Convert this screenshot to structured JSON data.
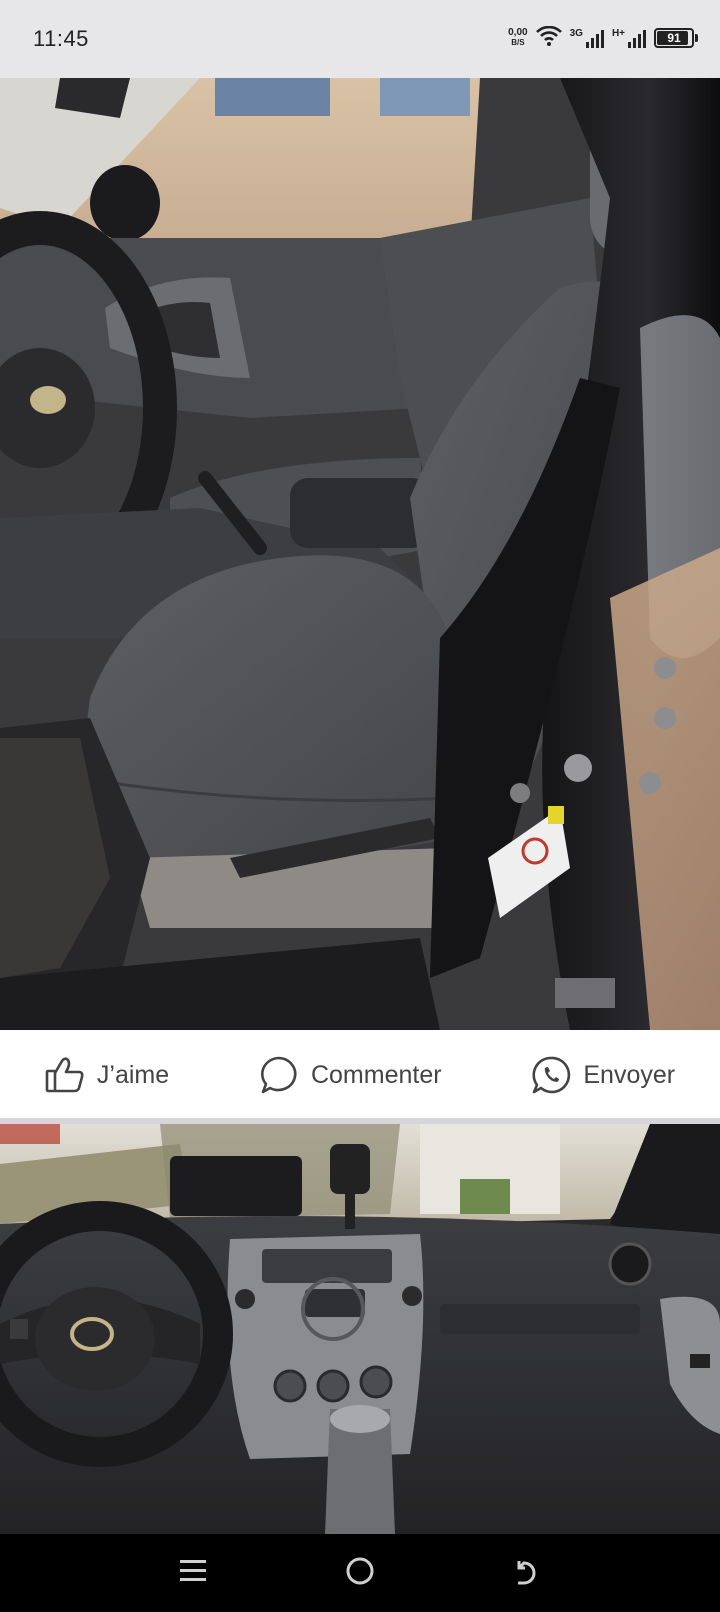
{
  "status_bar": {
    "time": "11:45",
    "net_speed_value": "0,00",
    "net_speed_unit": "B/S",
    "signal1_label": "3G",
    "signal2_label": "H+",
    "battery_percent": "91",
    "battery_level": 0.91,
    "icons": [
      "wifi-icon",
      "signal-icon",
      "battery-icon"
    ]
  },
  "post": {
    "photos": [
      {
        "description_icon": "car-interior-photo",
        "name": "photo-front-seat"
      },
      {
        "description_icon": "car-interior-photo",
        "name": "photo-dashboard"
      }
    ],
    "actions": {
      "like_label": "J’aime",
      "comment_label": "Commenter",
      "send_label": "Envoyer"
    }
  },
  "nav_bar": {
    "icons": [
      "menu-icon",
      "home-icon",
      "back-icon"
    ]
  },
  "colors": {
    "status_bg": "#e7e7ea",
    "action_bg": "#ffffff",
    "action_text": "#444444",
    "nav_bg": "#000000"
  }
}
